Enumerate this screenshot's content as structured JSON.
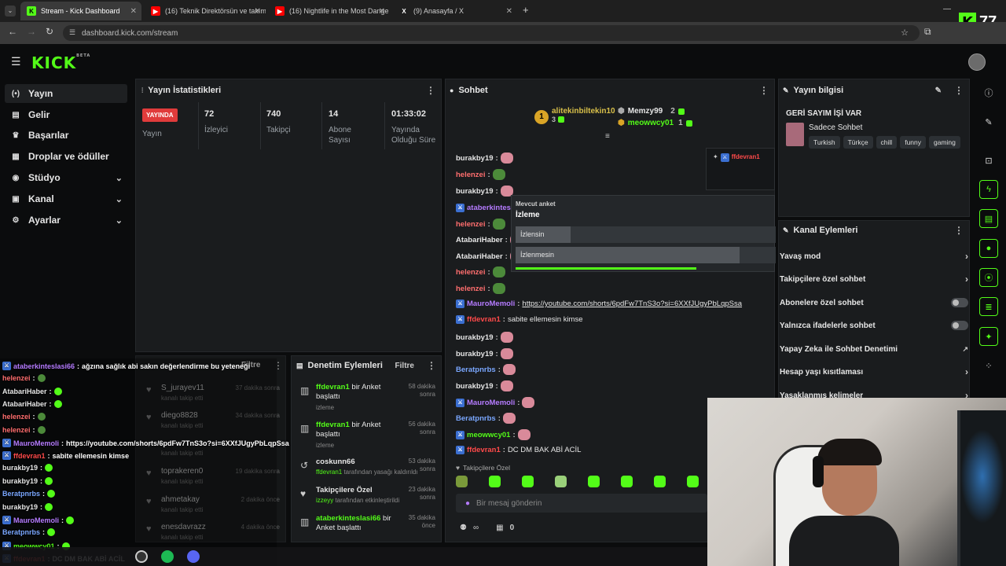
{
  "browser": {
    "tabs": [
      {
        "title": "Stream - Kick Dashboard",
        "icon": "K"
      },
      {
        "title": "(16) Teknik Direktörsün ve takım",
        "icon": "▶"
      },
      {
        "title": "(16) Nightlife in the Most Dange",
        "icon": "▶"
      },
      {
        "title": "(9) Anasayfa / X",
        "icon": "X"
      }
    ],
    "new_tab": "+",
    "url": "dashboard.kick.com/stream",
    "kick_counter": "77"
  },
  "app": {
    "logo": "KICK",
    "logo_beta": "BETA"
  },
  "sidebar": {
    "items": [
      {
        "label": "Yayın",
        "icon": "(•)"
      },
      {
        "label": "Gelir",
        "icon": "▤"
      },
      {
        "label": "Başarılar",
        "icon": "♛"
      },
      {
        "label": "Droplar ve ödüller",
        "icon": "▦"
      },
      {
        "label": "Stüdyo",
        "icon": "◉"
      },
      {
        "label": "Kanal",
        "icon": "▣"
      },
      {
        "label": "Ayarlar",
        "icon": "⚙"
      }
    ]
  },
  "stats": {
    "title": "Yayın İstatistikleri",
    "live_badge": "YAYINDA",
    "live_label": "Yayın",
    "viewers_value": "72",
    "viewers_label": "İzleyici",
    "followers_value": "740",
    "followers_label": "Takipçi",
    "subs_value": "14",
    "subs_label_1": "Abone",
    "subs_label_2": "Sayısı",
    "uptime_value": "01:33:02",
    "uptime_label_1": "Yayında",
    "uptime_label_2": "Olduğu Süre"
  },
  "chat": {
    "title": "Sohbet",
    "top_gifters": [
      {
        "name": "alitekinbiltekin10",
        "count": "3",
        "rank": "1"
      },
      {
        "name": "Memzy99",
        "count": "2"
      },
      {
        "name": "meowwcy01",
        "count": "1"
      }
    ],
    "poll": {
      "label": "Mevcut anket",
      "question": "İzleme",
      "options": [
        {
          "text": "İzlensin",
          "fraction": 0.21
        },
        {
          "text": "İzlenmesin",
          "fraction": 0.86
        }
      ]
    },
    "pinned_user": "ffdevran1",
    "messages": [
      {
        "user": "burakby19",
        "text": "",
        "color": "#e6e6e6"
      },
      {
        "user": "helenzei",
        "text": "",
        "color": "#ff6e6e"
      },
      {
        "user": "burakby19",
        "text": "",
        "color": "#e6e6e6"
      },
      {
        "user": "ataberkinteslasi66",
        "text": "",
        "color": "#b57bff"
      },
      {
        "user": "helenzei",
        "text": "",
        "color": "#ff6e6e"
      },
      {
        "user": "AtabariHaber",
        "text": "",
        "color": "#e6e6e6"
      },
      {
        "user": "AtabariHaber",
        "text": "",
        "color": "#e6e6e6"
      },
      {
        "user": "helenzei",
        "text": "",
        "color": "#ff6e6e"
      },
      {
        "user": "helenzei",
        "text": "",
        "color": "#ff6e6e"
      },
      {
        "user": "MauroMemoli",
        "text": "https://youtube.com/shorts/6pdFw7TnS3o?si=6XXfJUgyPbLqpSsa",
        "color": "#b57bff"
      },
      {
        "user": "ffdevran1",
        "text": "sabite ellemesin kimse",
        "color": "#ff4a4a"
      },
      {
        "user": "burakby19",
        "text": "",
        "color": "#e6e6e6"
      },
      {
        "user": "burakby19",
        "text": "",
        "color": "#e6e6e6"
      },
      {
        "user": "Beratpnrbs",
        "text": "",
        "color": "#7aa7ff"
      },
      {
        "user": "burakby19",
        "text": "",
        "color": "#e6e6e6"
      },
      {
        "user": "MauroMemoli",
        "text": "",
        "color": "#b57bff"
      },
      {
        "user": "Beratpnrbs",
        "text": "",
        "color": "#7aa7ff"
      },
      {
        "user": "meowwcy01",
        "text": "",
        "color": "#53fc18"
      },
      {
        "user": "ffdevran1",
        "text": "DC DM BAK ABİ ACİL",
        "color": "#ff4a4a"
      }
    ],
    "followers_only": "Takipçilere Özel",
    "input_placeholder": "Bir mesaj gönderin",
    "footer_infinite": "∞",
    "footer_count": "0"
  },
  "stream_info": {
    "title": "Yayın bilgisi",
    "stream_title": "GERİ SAYIM İŞİ VAR",
    "category": "Sadece Sohbet",
    "tags": [
      "Turkish",
      "Türkçe",
      "chill",
      "funny",
      "gaming"
    ]
  },
  "channel_actions": {
    "title": "Kanal Eylemleri",
    "items": [
      {
        "label": "Yavaş mod",
        "type": "arrow"
      },
      {
        "label": "Takipçilere özel sohbet",
        "type": "arrow"
      },
      {
        "label": "Abonelere özel sohbet",
        "type": "toggle"
      },
      {
        "label": "Yalnızca ifadelerle sohbet",
        "type": "toggle"
      },
      {
        "label": "Yapay Zeka ile Sohbet Denetimi",
        "type": "external"
      },
      {
        "label": "Hesap yaşı kısıtlaması",
        "type": "arrow"
      },
      {
        "label": "Yasaklanmış kelimeler",
        "type": "arrow"
      }
    ]
  },
  "followers_panel": {
    "filter": "Filtre",
    "rows": [
      {
        "user": "S_jurayev11",
        "sub": "kanalı takip etti",
        "time": "37 dakika sonra"
      },
      {
        "user": "diego8828",
        "sub": "kanalı takip etti",
        "time": "34 dakika sonra"
      },
      {
        "user": "",
        "sub": "kanalı takip etti",
        "time": ""
      },
      {
        "user": "toprakeren0",
        "sub": "kanalı takip etti",
        "time": "19 dakika sonra"
      },
      {
        "user": "ahmetakay",
        "sub": "kanalı takip etti",
        "time": "2 dakika önce"
      },
      {
        "user": "enesdavrazz",
        "sub": "kanalı takip etti",
        "time": "4 dakika önce"
      }
    ]
  },
  "mod_panel": {
    "title": "Denetim Eylemleri",
    "filter": "Filtre",
    "rows": [
      {
        "user": "ffdevran1",
        "action": " bir Anket başlattı",
        "sub": "izleme",
        "time": "58 dakika sonra",
        "icon": "▥"
      },
      {
        "user": "ffdevran1",
        "action": " bir Anket başlattı",
        "sub": "izleme",
        "time": "56 dakika sonra",
        "icon": "▥"
      },
      {
        "user": "coskunn66",
        "action": "",
        "sub_user": "ffdevran1",
        "sub": " tarafından yasağı kaldırıldı",
        "time": "53 dakika sonra",
        "icon": "↺"
      },
      {
        "user": "Takipçilere Özel",
        "action": "",
        "sub_user": "izzeyy",
        "sub": " tarafından etkinleştirildi",
        "time": "23 dakika sonra",
        "icon": "♥"
      },
      {
        "user": "ataberkinteslasi66",
        "action": " bir Anket başlattı",
        "sub": "",
        "time": "35 dakika önce",
        "icon": "▥"
      }
    ]
  },
  "overlay_chat": [
    {
      "user": "ataberkinteslasi66",
      "text": "ağzına sağlık abi sakın değerlendirme bu yeteneği",
      "color": "#b57bff"
    },
    {
      "user": "helenzei",
      "text": "",
      "color": "#ff6e6e"
    },
    {
      "user": "AtabariHaber",
      "text": "",
      "color": "#e6e6e6"
    },
    {
      "user": "AtabariHaber",
      "text": "",
      "color": "#e6e6e6"
    },
    {
      "user": "helenzei",
      "text": "",
      "color": "#ff6e6e"
    },
    {
      "user": "helenzei",
      "text": "",
      "color": "#ff6e6e"
    },
    {
      "user": "MauroMemoli",
      "text": "https://youtube.com/shorts/6pdFw7TnS3o?si=6XXfJUgyPbLqpSsa",
      "color": "#b57bff"
    },
    {
      "user": "ffdevran1",
      "text": "sabite ellemesin kimse",
      "color": "#ff4a4a"
    },
    {
      "user": "burakby19",
      "text": "",
      "color": "#e6e6e6"
    },
    {
      "user": "burakby19",
      "text": "",
      "color": "#e6e6e6"
    },
    {
      "user": "Beratpnrbs",
      "text": "",
      "color": "#7aa7ff"
    },
    {
      "user": "burakby19",
      "text": "",
      "color": "#e6e6e6"
    },
    {
      "user": "MauroMemoli",
      "text": "",
      "color": "#b57bff"
    },
    {
      "user": "Beratpnrbs",
      "text": "",
      "color": "#7aa7ff"
    },
    {
      "user": "meowwcy01",
      "text": "",
      "color": "#53fc18"
    },
    {
      "user": "ffdevran1",
      "text": "DC DM BAK ABİ ACİL",
      "color": "#ff4a4a"
    }
  ],
  "colors": {
    "brand": "#53fc18",
    "live": "#e03b3b",
    "panel": "#1a1c1e"
  }
}
